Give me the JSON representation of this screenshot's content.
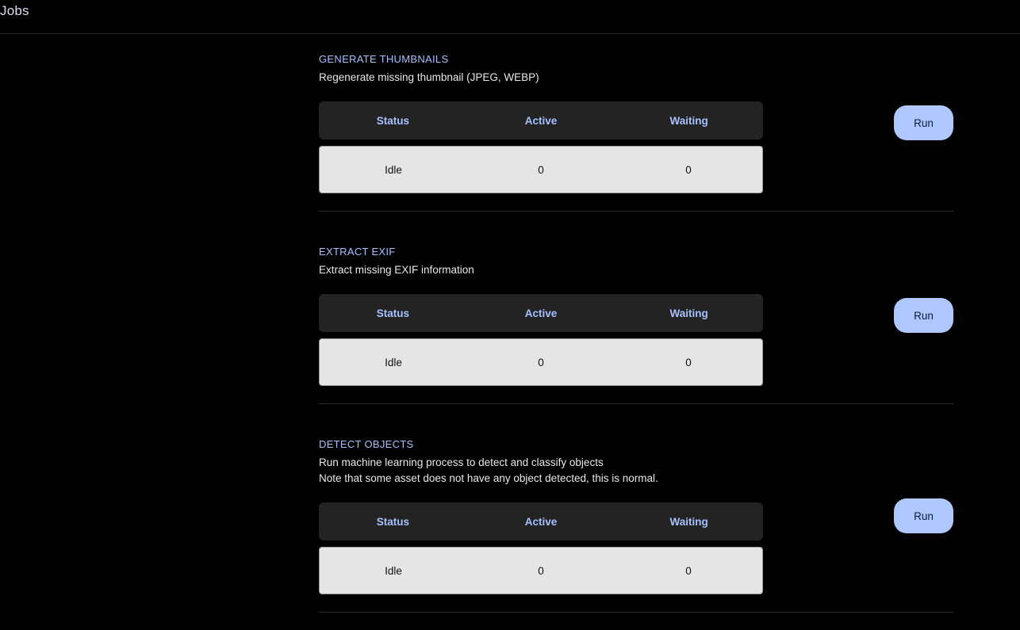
{
  "page": {
    "title": "Jobs"
  },
  "table_headers": {
    "status": "Status",
    "active": "Active",
    "waiting": "Waiting"
  },
  "jobs": [
    {
      "title": "GENERATE THUMBNAILS",
      "description": [
        "Regenerate missing thumbnail (JPEG, WEBP)"
      ],
      "status": "Idle",
      "active": "0",
      "waiting": "0",
      "button": "Run"
    },
    {
      "title": "EXTRACT EXIF",
      "description": [
        "Extract missing EXIF information"
      ],
      "status": "Idle",
      "active": "0",
      "waiting": "0",
      "button": "Run"
    },
    {
      "title": "DETECT OBJECTS",
      "description": [
        "Run machine learning process to detect and classify objects",
        "Note that some asset does not have any object detected, this is normal."
      ],
      "status": "Idle",
      "active": "0",
      "waiting": "0",
      "button": "Run"
    }
  ],
  "colors": {
    "background": "#000000",
    "accent": "#a7c0ff",
    "button_bg": "#aec8ff",
    "table_header_bg": "#232323",
    "table_row_bg": "#e5e5e5"
  }
}
